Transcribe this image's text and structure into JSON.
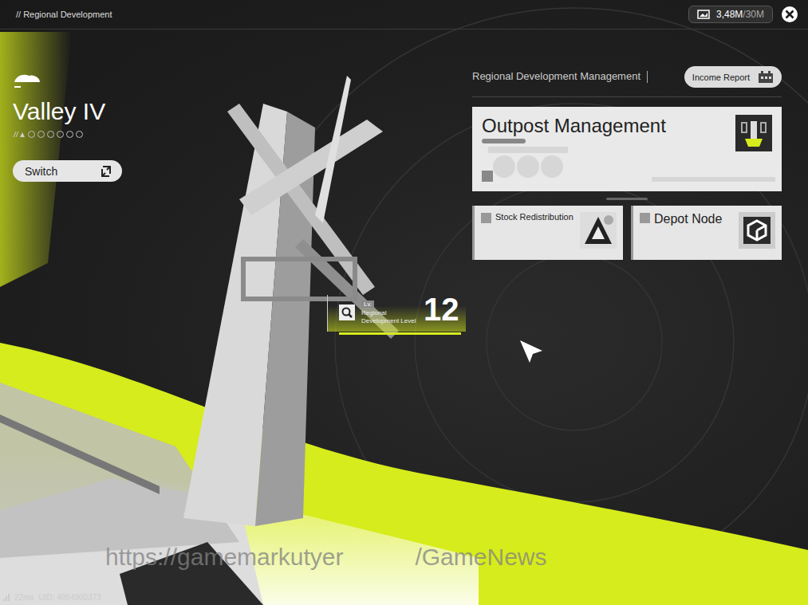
{
  "header": {
    "breadcrumb": "// Regional Development",
    "currency": "3,48M",
    "currency_max": "/30M"
  },
  "region": {
    "name": "Valley IV",
    "dots": [
      {
        "filled": false
      },
      {
        "filled": false
      },
      {
        "filled": false
      },
      {
        "filled": false
      },
      {
        "filled": false
      },
      {
        "filled": false
      }
    ],
    "switch_label": "Switch"
  },
  "level": {
    "prefix": "Lv.",
    "value": "12",
    "caption": "Regional Development Level"
  },
  "management": {
    "title": "Regional Development Management",
    "income_report": "Income Report",
    "cards": [
      {
        "label": "Outpost Management",
        "kind": "large"
      },
      {
        "label": "Stock Redistribution",
        "kind": "small"
      },
      {
        "label": "Depot Node",
        "kind": "small"
      }
    ]
  },
  "status_bar": {
    "ping": "22ms",
    "uid": "UID: 4854900373"
  },
  "watermark": [
    "https://gamemarkutyer",
    "/GameNews"
  ]
}
